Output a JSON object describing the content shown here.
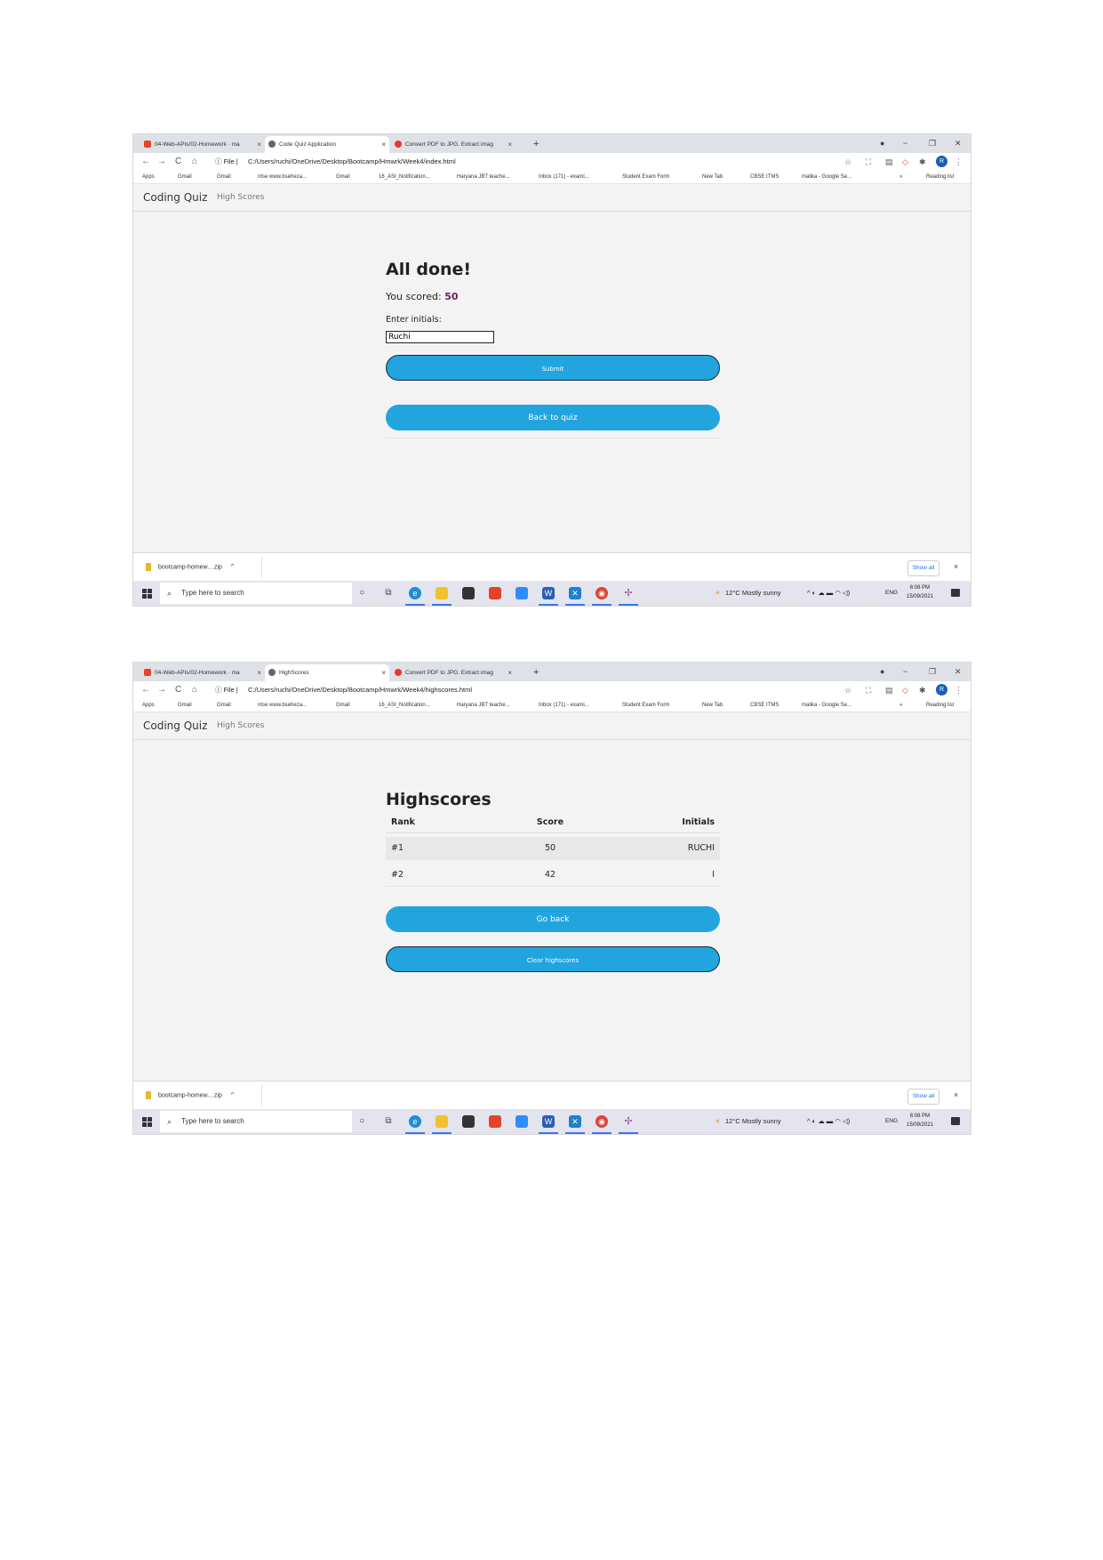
{
  "browser": {
    "tabs": [
      {
        "title": "04-Web-APIs/02-Homework · ma",
        "close": "×"
      },
      {
        "title": "Code Quiz Application",
        "close": "×"
      },
      {
        "title": "Convert PDF to JPG. Extract imag",
        "close": "×"
      }
    ],
    "tabs_shot2": [
      {
        "title": "04-Web-APIs/02-Homework · ma",
        "close": "×"
      },
      {
        "title": "HighScores",
        "close": "×"
      },
      {
        "title": "Convert PDF to JPG. Extract imag",
        "close": "×"
      }
    ],
    "new_tab": "+",
    "nav": {
      "back": "←",
      "forward": "→",
      "reload": "C",
      "home": "⌂"
    },
    "url_prefix": "ⓘ File |",
    "url_shot1": "C:/Users/ruchi/OneDrive/Desktop/Bootcamp/Hmwrk/Week4/index.html",
    "url_shot2": "C:/Users/ruchi/OneDrive/Desktop/Bootcamp/Hmwrk/Week4/highscores.html",
    "avatar": "R",
    "window_controls": {
      "minimize": "−",
      "maximize": "❐",
      "close": "✕"
    },
    "bookmarks": [
      "Apps",
      "Gmail",
      "Gmail",
      "ntse www.bseheza...",
      "Gmail",
      "16_ASI_Notification...",
      "Haryana JBT teache...",
      "Inbox (171) - exami...",
      "Student Exam Form",
      "New Tab",
      "CBSE ITMS",
      "malika - Google Se..."
    ],
    "bookmarks_more": "»",
    "reading_list": "Reading list"
  },
  "app": {
    "brand": "Coding Quiz",
    "nav_link": "High Scores"
  },
  "done_screen": {
    "title": "All done!",
    "score_prefix": "You scored:",
    "score_value": "50",
    "initials_label": "Enter initials:",
    "initials_value": "Ruchi",
    "submit_label": "Submit",
    "back_label": "Back to quiz"
  },
  "highscores_screen": {
    "title": "Highscores",
    "columns": [
      "Rank",
      "Score",
      "Initials"
    ],
    "rows": [
      {
        "rank": "#1",
        "score": "50",
        "initials": "RUCHI"
      },
      {
        "rank": "#2",
        "score": "42",
        "initials": "I"
      }
    ],
    "go_back_label": "Go back",
    "clear_label": "Clear highscores"
  },
  "downloads": {
    "file": "bootcamp-homew....zip",
    "caret": "^",
    "show_all": "Show all",
    "close": "×"
  },
  "taskbar": {
    "search_placeholder": "Type here to search",
    "weather": "12°C  Mostly sunny",
    "lang": "ENG",
    "time": "6:08 PM",
    "date": "15/09/2021",
    "apps": [
      "cortana",
      "task-view",
      "edge",
      "file-explorer",
      "store",
      "office",
      "zoom",
      "word",
      "vscode",
      "chrome",
      "slack"
    ]
  }
}
